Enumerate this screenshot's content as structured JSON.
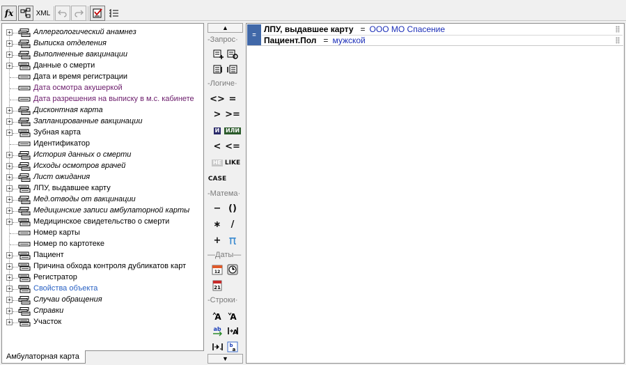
{
  "toolbar": {
    "fx_label": "fx",
    "xml_label": "XML"
  },
  "tree": {
    "items": [
      {
        "label": "Аллергологический анамнез",
        "kind": "relation",
        "expandable": true
      },
      {
        "label": "Выписка отделения",
        "kind": "relation",
        "expandable": true
      },
      {
        "label": "Выполненные вакцинации",
        "kind": "relation",
        "expandable": true
      },
      {
        "label": "Данные о смерти",
        "kind": "object",
        "expandable": true
      },
      {
        "label": "Дата и время регистрации",
        "kind": "field",
        "expandable": false
      },
      {
        "label": "Дата осмотра акушеркой",
        "kind": "field-purple",
        "expandable": false
      },
      {
        "label": "Дата разрешения на выписку в м.с. кабинете",
        "kind": "field-purple",
        "expandable": false
      },
      {
        "label": "Дисконтная карта",
        "kind": "relation",
        "expandable": true
      },
      {
        "label": "Запланированные вакцинации",
        "kind": "relation",
        "expandable": true
      },
      {
        "label": "Зубная карта",
        "kind": "object",
        "expandable": true
      },
      {
        "label": "Идентификатор",
        "kind": "field",
        "expandable": false
      },
      {
        "label": "История данных о смерти",
        "kind": "relation",
        "expandable": true
      },
      {
        "label": "Исходы осмотров врачей",
        "kind": "relation",
        "expandable": true
      },
      {
        "label": "Лист ожидания",
        "kind": "relation",
        "expandable": true
      },
      {
        "label": "ЛПУ, выдавшее карту",
        "kind": "object",
        "expandable": true
      },
      {
        "label": "Мед.отводы от вакцинации",
        "kind": "relation",
        "expandable": true
      },
      {
        "label": "Медицинские записи амбулаторной карты",
        "kind": "relation",
        "expandable": true
      },
      {
        "label": "Медицинское свидетельство о смерти",
        "kind": "object",
        "expandable": true
      },
      {
        "label": "Номер карты",
        "kind": "field",
        "expandable": false
      },
      {
        "label": "Номер по картотеке",
        "kind": "field",
        "expandable": false
      },
      {
        "label": "Пациент",
        "kind": "object",
        "expandable": true
      },
      {
        "label": "Причина обхода контроля дубликатов карт",
        "kind": "object",
        "expandable": true
      },
      {
        "label": "Регистратор",
        "kind": "object",
        "expandable": true
      },
      {
        "label": "Свойства объекта",
        "kind": "object-blue",
        "expandable": true
      },
      {
        "label": "Случаи обращения",
        "kind": "relation",
        "expandable": true
      },
      {
        "label": "Справки",
        "kind": "relation",
        "expandable": true
      },
      {
        "label": "Участок",
        "kind": "object",
        "expandable": true
      }
    ]
  },
  "tab": {
    "label": "Амбулаторная карта"
  },
  "palette": {
    "groups": {
      "query": "Запрос",
      "logic": "Логиче",
      "math": "Матема",
      "dates": "Даты",
      "strings": "Строки"
    },
    "logic_ops": {
      "neq": "<>",
      "eq": "=",
      "gt": ">",
      "gte": ">=",
      "and": "И",
      "or": "ИЛИ",
      "lt": "<",
      "lte": "<=",
      "not": "НЕ",
      "like": "LIKE",
      "case": "CASE"
    },
    "math_ops": {
      "minus": "−",
      "parens": "()",
      "mult": "∗",
      "div": "/",
      "plus": "+",
      "pi": "π"
    },
    "calendar_day": "21",
    "calendar_small": "12"
  },
  "conditions": {
    "group_symbol": "=",
    "rows": [
      {
        "field": "ЛПУ, выдавшее карту",
        "op": "=",
        "value": "ООО МО Спасение"
      },
      {
        "field": "Пациент.Пол",
        "op": "=",
        "value": "мужской"
      }
    ]
  }
}
